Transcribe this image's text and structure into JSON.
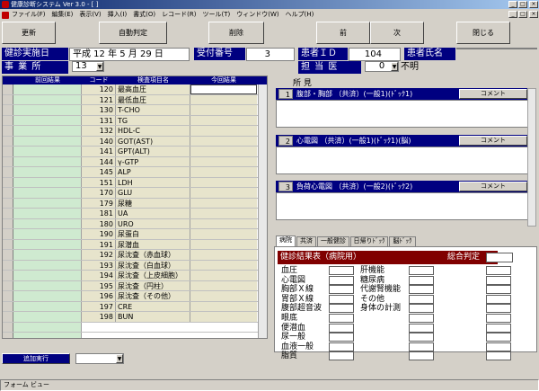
{
  "window": {
    "title": "健康診断システム Ver 3.0 - [ ]",
    "controls": {
      "minimize": "_",
      "maximize": "□",
      "close": "×"
    }
  },
  "menu": {
    "items": [
      "ファイル(F)",
      "編集(E)",
      "表示(V)",
      "挿入(I)",
      "書式(O)",
      "レコード(R)",
      "ツール(T)",
      "ウィンドウ(W)",
      "ヘルプ(H)"
    ],
    "doc_controls": {
      "minimize": "_",
      "restore": "□",
      "close": "×"
    }
  },
  "toolbar": {
    "update": "更新",
    "auto_judge": "自動判定",
    "delete": "削除",
    "prev": "前",
    "next": "次",
    "close": "閉じる"
  },
  "header": {
    "exam_date_label": "健診実施日",
    "exam_date_value": "平成 12 年 5 月 29 日",
    "reception_label": "受付番号",
    "reception_value": "3",
    "patient_id_label": "患者ＩＤ",
    "patient_id_value": "104",
    "patient_name_label": "患者氏名",
    "patient_name_value": "",
    "office_label": "事 業 所",
    "office_value": "13",
    "doctor_label": "担 当 医",
    "doctor_value": "0",
    "doctor_name": "不明"
  },
  "table": {
    "columns": {
      "prev": "前回結果",
      "code": "コード",
      "name": "検査項目名",
      "current": "今回結果"
    },
    "rows": [
      {
        "code": "120",
        "name": "最高血圧"
      },
      {
        "code": "121",
        "name": "最低血圧"
      },
      {
        "code": "130",
        "name": "T-CHO"
      },
      {
        "code": "131",
        "name": "TG"
      },
      {
        "code": "132",
        "name": "HDL-C"
      },
      {
        "code": "140",
        "name": "GOT(AST)"
      },
      {
        "code": "141",
        "name": "GPT(ALT)"
      },
      {
        "code": "144",
        "name": "γ-GTP"
      },
      {
        "code": "145",
        "name": "ALP"
      },
      {
        "code": "151",
        "name": "LDH"
      },
      {
        "code": "170",
        "name": "GLU"
      },
      {
        "code": "179",
        "name": "尿糖"
      },
      {
        "code": "181",
        "name": "UA"
      },
      {
        "code": "180",
        "name": "URO"
      },
      {
        "code": "190",
        "name": "尿蛋白"
      },
      {
        "code": "191",
        "name": "尿潜血"
      },
      {
        "code": "192",
        "name": "尿沈査（赤血球）"
      },
      {
        "code": "193",
        "name": "尿沈査（白血球）"
      },
      {
        "code": "194",
        "name": "尿沈査（上皮細胞）"
      },
      {
        "code": "195",
        "name": "尿沈査（円柱）"
      },
      {
        "code": "196",
        "name": "尿沈査（その他）"
      },
      {
        "code": "197",
        "name": "CRE"
      },
      {
        "code": "198",
        "name": "BUN"
      }
    ],
    "add_button": "追加実行",
    "add_select_value": ""
  },
  "findings": {
    "label": "所 見",
    "comment_label": "コメント",
    "sections": [
      {
        "num": "1",
        "title": "腹部・胸部 （共済）(一般1)(ﾄﾞｯｸ1)"
      },
      {
        "num": "2",
        "title": "心電図 （共済）(一般1)(ﾄﾞｯｸ1)(脳)"
      },
      {
        "num": "3",
        "title": "負荷心電図 （共済）(一般2)(ﾄﾞｯｸ2)"
      }
    ]
  },
  "tabs": [
    "病院",
    "共済",
    "一般健診",
    "日帰りﾄﾞｯｸ",
    "脳ﾄﾞｯｸ"
  ],
  "result_panel": {
    "title": "健診結果表（病院用）",
    "overall_label": "総合判定",
    "overall_value": "",
    "left_items": [
      "血圧",
      "心電図",
      "胸部Ｘ線",
      "胃部Ｘ線",
      "腹部超音波",
      "眼底",
      "便潜血",
      "尿一般",
      "血液一般",
      "脂質"
    ],
    "right_items": [
      "肝機能",
      "糖尿病",
      "代謝腎機能",
      "その他",
      "身体の計測"
    ]
  },
  "status_bar": {
    "text": "フォーム ビュー"
  }
}
